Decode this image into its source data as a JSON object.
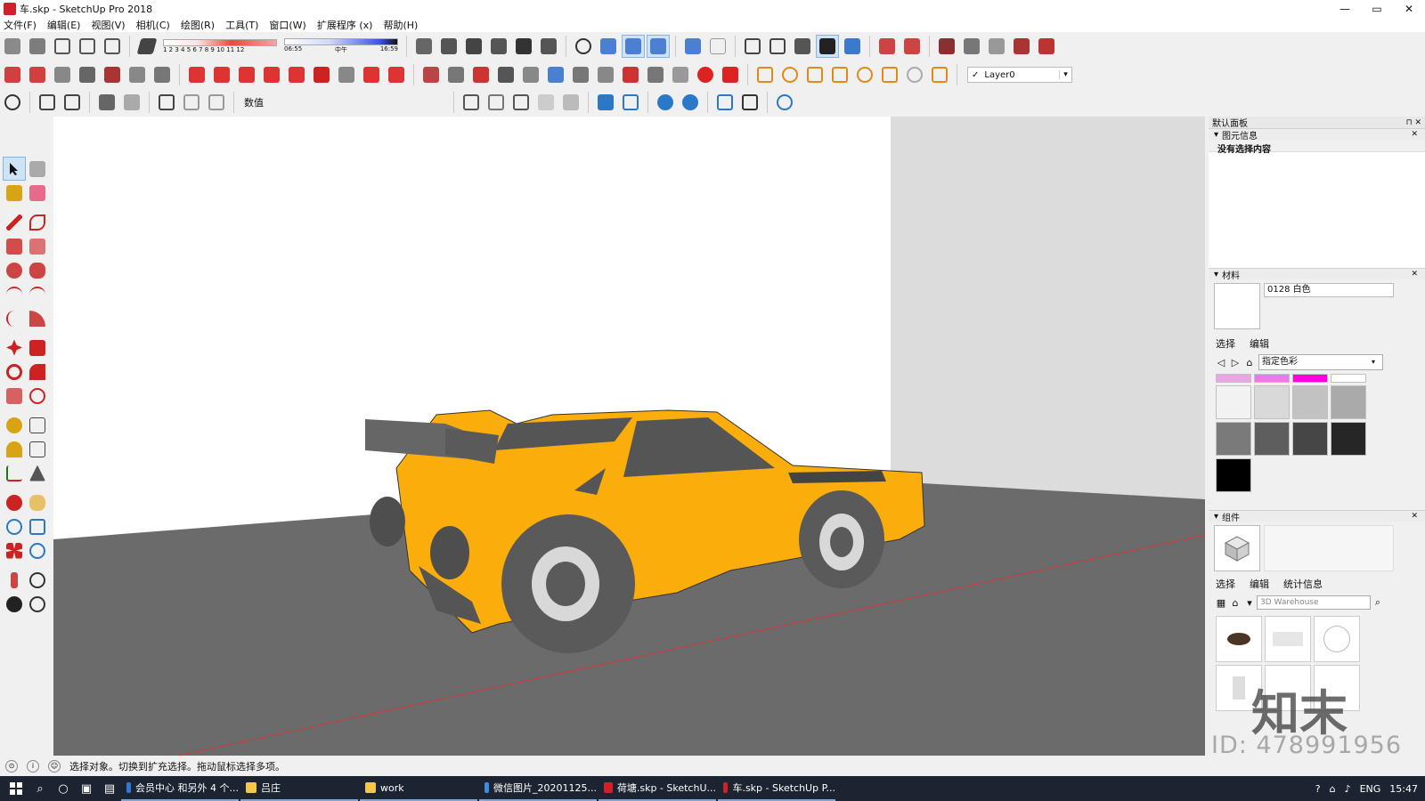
{
  "window": {
    "title": "车.skp - SketchUp Pro 2018",
    "controls": {
      "minimize": "—",
      "maximize": "▭",
      "close": "✕"
    }
  },
  "menu": [
    "文件(F)",
    "编辑(E)",
    "视图(V)",
    "相机(C)",
    "绘图(R)",
    "工具(T)",
    "窗口(W)",
    "扩展程序 (x)",
    "帮助(H)"
  ],
  "shadow_bar": {
    "months": "1 2 3 4 5 6 7 8 9 10 11 12",
    "time_start": "06:55",
    "time_mid": "中午",
    "time_end": "16:59"
  },
  "layer": {
    "check": "✓",
    "name": "Layer0",
    "arrow": "▾"
  },
  "measurements_label": "数值",
  "viewport": {
    "colors": {
      "wall_left": "#ffffff",
      "wall_right": "#dcdcdc",
      "floor": "#6b6b6b",
      "car_body": "#fbad0b",
      "tire": "#555555",
      "rim": "#d8d8d8",
      "axis_red": "#d23a3a"
    }
  },
  "tray": {
    "title": "默认面板",
    "pin": "⊓ ✕",
    "entity_info": {
      "header": "图元信息",
      "close": "✕",
      "text": "没有选择内容"
    },
    "materials": {
      "header": "材料",
      "close": "✕",
      "name": "0128 白色",
      "tabs": [
        "选择",
        "编辑"
      ],
      "collection": "指定色彩",
      "nav": {
        "back": "◁",
        "forward": "▷",
        "home": "⌂"
      },
      "arrow": "▾",
      "swatch_colors": [
        "#e8a6e4",
        "#ee7ae8",
        "#ff00e0",
        "#ffffff",
        "#f2f2f2",
        "#d9d9d9",
        "#c2c2c2",
        "#aaaaaa",
        "#7a7a7a",
        "#5e5e5e",
        "#464646",
        "#262626",
        "#000000"
      ]
    },
    "components": {
      "header": "组件",
      "close": "✕",
      "tabs": [
        "选择",
        "编辑",
        "统计信息"
      ],
      "search_placeholder": "3D Warehouse",
      "search_icon": "⌕",
      "arrow": "▾"
    }
  },
  "watermark": {
    "id": "ID: 478991956",
    "logo": "知末"
  },
  "status": {
    "text": "选择对象。切换到扩充选择。拖动鼠标选择多项。"
  },
  "taskbar": {
    "tasks": [
      "会员中心 和另外 4 个...",
      "吕庄",
      "work",
      "微信图片_20201125...",
      "荷塘.skp - SketchU...",
      "车.skp - SketchUp P..."
    ],
    "task_colors": [
      "#2d7ad6",
      "#f3c74b",
      "#f3c74b",
      "#3a8de0",
      "#d0202a",
      "#d0202a"
    ],
    "lang": "ENG",
    "clock": "15:47"
  }
}
